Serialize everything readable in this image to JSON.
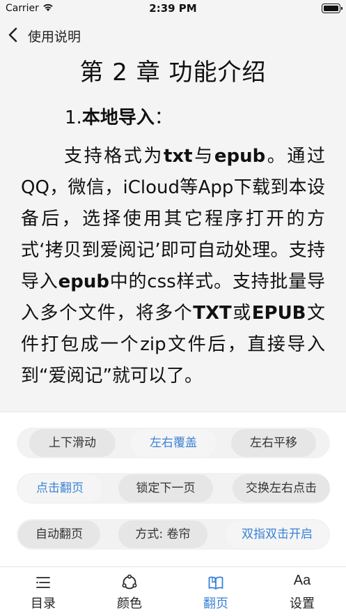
{
  "status": {
    "carrier": "Carrier",
    "time": "2:39 PM"
  },
  "nav": {
    "back_label": "使用说明"
  },
  "reader": {
    "chapter_title": "第 2 章  功能介绍",
    "section_number": "1.",
    "section_title": "本地导入",
    "section_colon": "：",
    "body": [
      {
        "text": "支持格式为",
        "bold": false
      },
      {
        "text": "txt",
        "bold": true
      },
      {
        "text": "与",
        "bold": false
      },
      {
        "text": "epub",
        "bold": true
      },
      {
        "text": "。通过QQ，微信，iCloud等App下载到本设备后，选择使用其它程序打开的方式‘拷贝到爱阅记’即可自动处理。支持导入",
        "bold": false
      },
      {
        "text": "epub",
        "bold": true
      },
      {
        "text": "中的css样式。支持批量导入多个文件，将多个",
        "bold": false
      },
      {
        "text": "TXT",
        "bold": true
      },
      {
        "text": "或",
        "bold": false
      },
      {
        "text": "EPUB",
        "bold": true
      },
      {
        "text": "文件打包成一个zip文件后，直接导入到“爱阅记”就可以了。",
        "bold": false
      }
    ]
  },
  "settings": {
    "scroll_modes": [
      "上下滑动",
      "左右覆盖",
      "左右平移"
    ],
    "scroll_active": 1,
    "tap_modes": [
      "点击翻页",
      "锁定下一页",
      "交换左右点击"
    ],
    "tap_active": 0,
    "auto": {
      "auto_page": "自动翻页",
      "method": "方式: 卷帘",
      "double_tap": "双指双击开启"
    }
  },
  "tabs": [
    {
      "label": "目录",
      "icon": "list-icon"
    },
    {
      "label": "颜色",
      "icon": "palette-icon"
    },
    {
      "label": "翻页",
      "icon": "book-icon"
    },
    {
      "label": "设置",
      "icon": "font-size-icon",
      "glyph": "Aa"
    }
  ],
  "tab_active": 2,
  "colors": {
    "accent": "#3b82d6",
    "background": "#f4f4f4"
  }
}
